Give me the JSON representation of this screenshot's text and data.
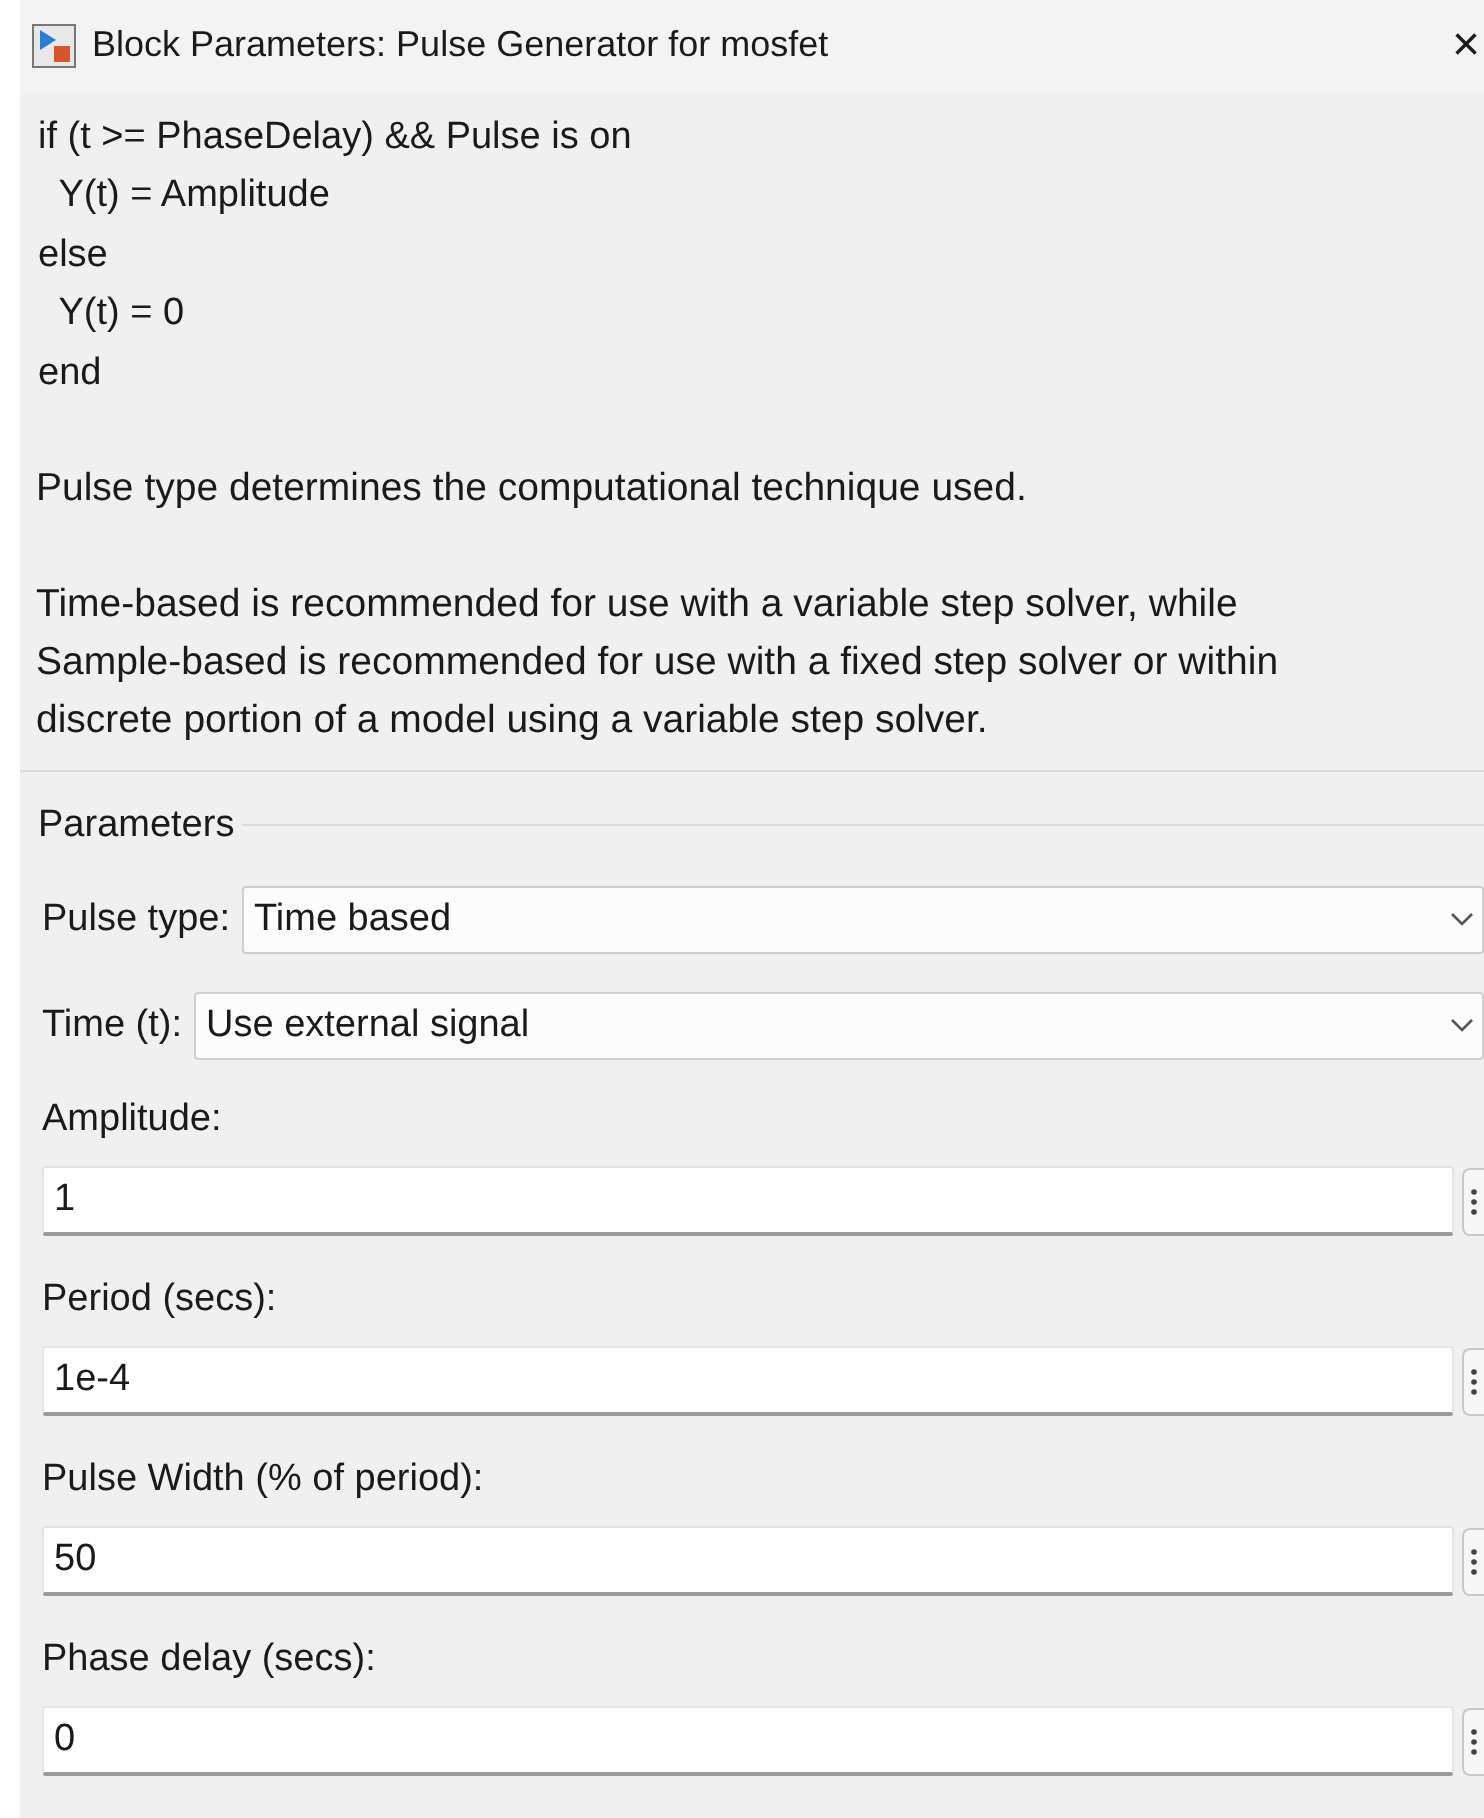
{
  "window": {
    "title": "Block Parameters: Pulse Generator for mosfet",
    "close": "×"
  },
  "description": {
    "code_lines": [
      "if (t >= PhaseDelay) && Pulse is on",
      "  Y(t) = Amplitude",
      "else",
      "  Y(t) = 0",
      "end"
    ],
    "paragraphs": [
      "Pulse type determines the computational technique used.",
      "Time-based is recommended for use with a variable step solver, while Sample-based is recommended for use with a fixed step solver or within discrete portion of a model using a variable step solver."
    ]
  },
  "parameters": {
    "title": "Parameters",
    "dropdowns": [
      {
        "label": "Pulse type:",
        "value": "Time based"
      },
      {
        "label": "Time (t):",
        "value": "Use external signal"
      }
    ],
    "fields": [
      {
        "label": "Amplitude:",
        "value": "1"
      },
      {
        "label": "Period (secs):",
        "value": "1e-4"
      },
      {
        "label": "Pulse Width (% of period):",
        "value": "50"
      },
      {
        "label": "Phase delay (secs):",
        "value": "0"
      }
    ]
  }
}
